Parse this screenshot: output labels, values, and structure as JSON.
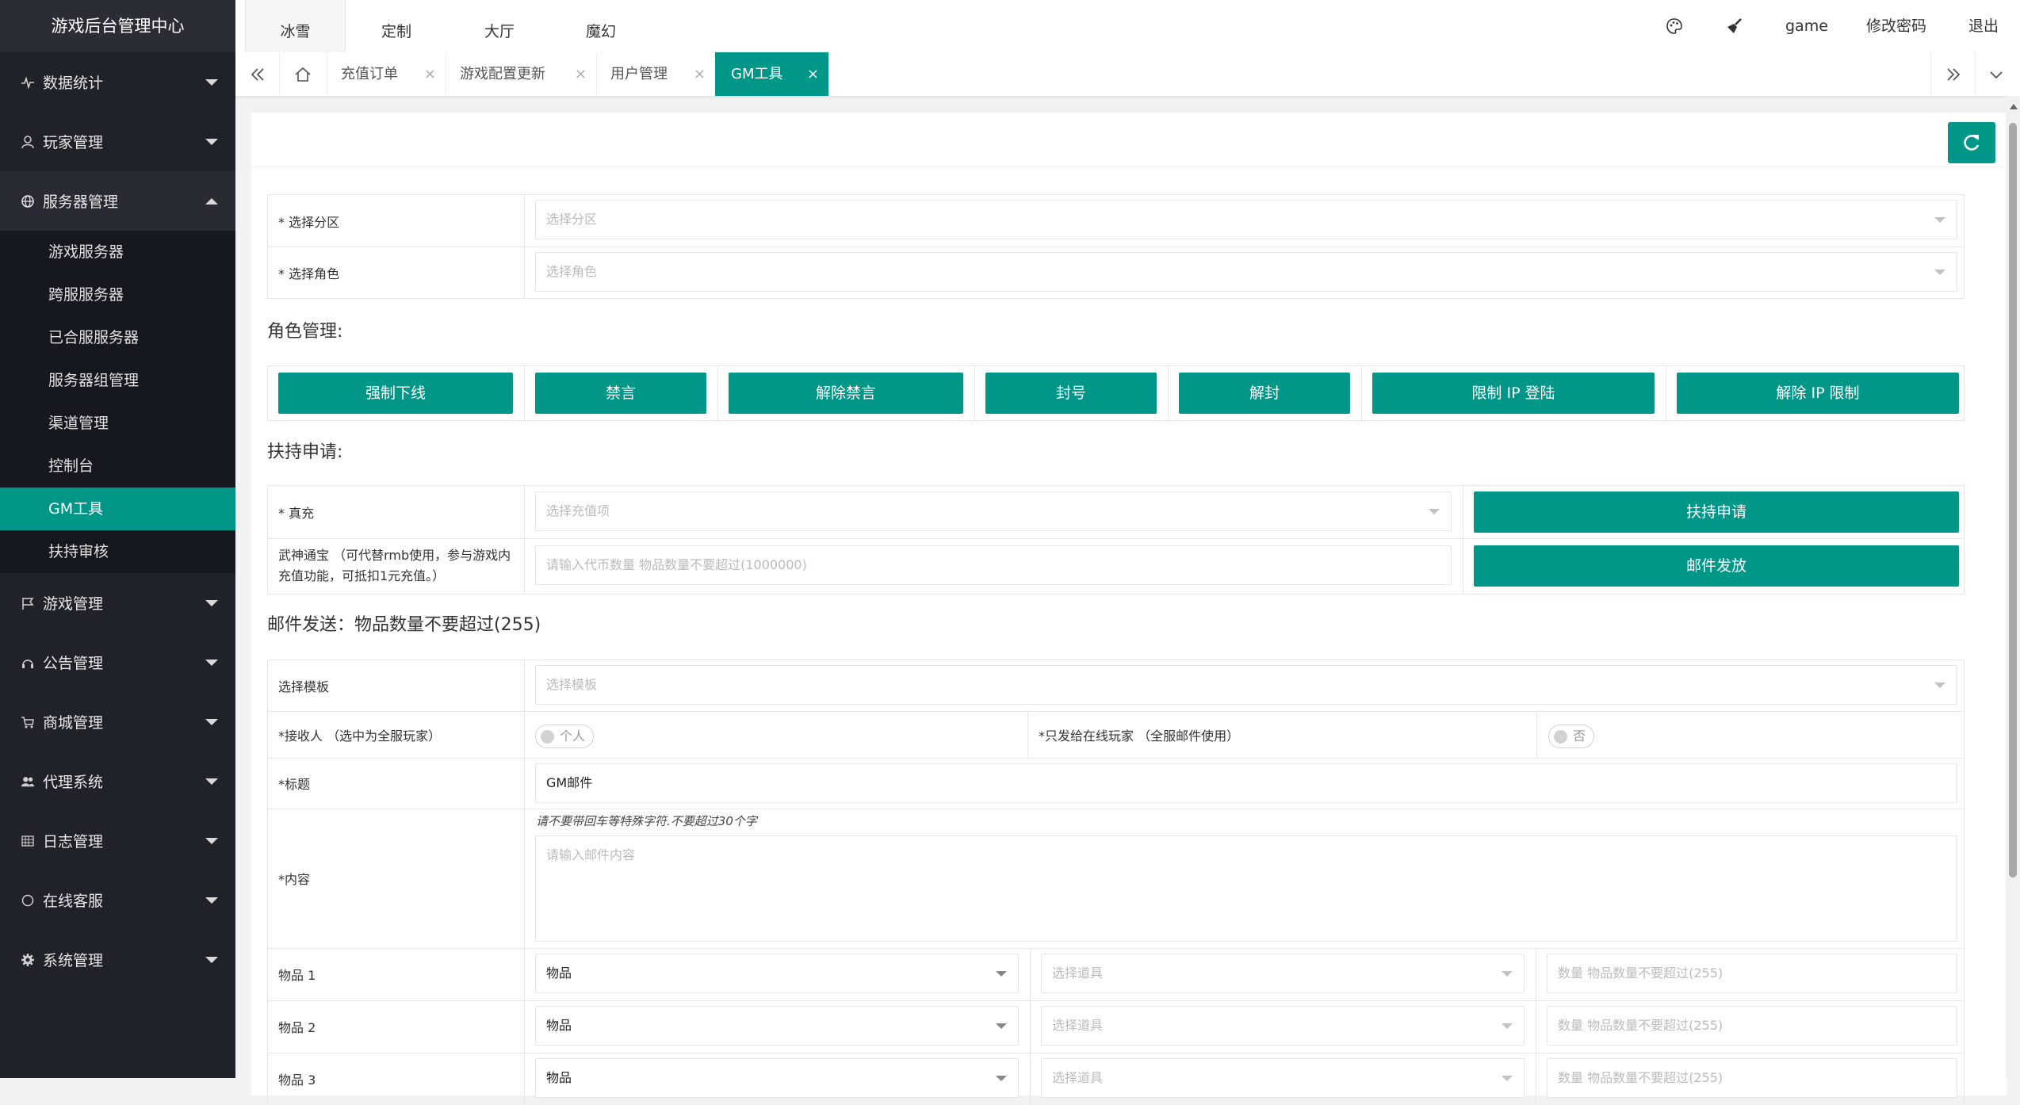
{
  "app_title": "游戏后台管理中心",
  "top_tabs": [
    "冰雪",
    "定制",
    "大厅",
    "魔幻"
  ],
  "header_right": {
    "theme_icon": "palette-icon",
    "clean_icon": "broom-icon",
    "user": "game",
    "change_password": "修改密码",
    "logout": "退出"
  },
  "sidebar": {
    "menus": [
      {
        "label": "数据统计",
        "icon": "pulse-icon"
      },
      {
        "label": "玩家管理",
        "icon": "user-icon"
      },
      {
        "label": "服务器管理",
        "icon": "globe-icon"
      },
      {
        "label": "游戏管理",
        "icon": "flag-icon"
      },
      {
        "label": "公告管理",
        "icon": "headset-icon"
      },
      {
        "label": "商城管理",
        "icon": "cart-icon"
      },
      {
        "label": "代理系统",
        "icon": "users-icon"
      },
      {
        "label": "日志管理",
        "icon": "grid-icon"
      },
      {
        "label": "在线客服",
        "icon": "circle-icon"
      },
      {
        "label": "系统管理",
        "icon": "gear-icon"
      }
    ],
    "submenu": [
      "游戏服务器",
      "跨服服务器",
      "已合服服务器",
      "服务器组管理",
      "渠道管理",
      "控制台",
      "GM工具",
      "扶持审核"
    ],
    "active_submenu": "GM工具"
  },
  "page_tabs": [
    {
      "label": "充值订单",
      "close": "×"
    },
    {
      "label": "游戏配置更新",
      "close": "×"
    },
    {
      "label": "用户管理",
      "close": "×"
    },
    {
      "label": "GM工具",
      "close": "×"
    }
  ],
  "form": {
    "zone_label": "* 选择分区",
    "zone_placeholder": "选择分区",
    "role_label": "* 选择角色",
    "role_placeholder": "选择角色",
    "role_section_title": "角色管理:",
    "role_buttons": [
      "强制下线",
      "禁言",
      "解除禁言",
      "封号",
      "解封",
      "限制 IP 登陆",
      "解除 IP 限制"
    ],
    "support_section_title": "扶持申请:",
    "recharge_label": "* 真充",
    "recharge_placeholder": "选择充值项",
    "support_button": "扶持申请",
    "currency_label": "武神通宝 （可代替rmb使用，参与游戏内充值功能，可抵扣1元充值。）",
    "currency_placeholder": "请输入代币数量  物品数量不要超过(1000000)",
    "mail_send_button": "邮件发放",
    "mail_section_title": "邮件发送：物品数量不要超过(255)",
    "template_label": "选择模板",
    "template_placeholder": "选择模板",
    "receiver_label": "*接收人  （选中为全服玩家）",
    "receiver_switch": "个人",
    "online_label": "*只发给在线玩家  （全服邮件使用）",
    "online_switch": "否",
    "title_label": "*标题",
    "title_value": "GM邮件",
    "content_label": "*内容",
    "content_hint": "请不要带回车等特殊字符.不要超过30个字",
    "content_placeholder": "请输入邮件内容",
    "items": [
      {
        "label": "物品 1",
        "type": "物品",
        "prop_placeholder": "选择道具",
        "qty_placeholder": "数量 物品数量不要超过(255)"
      },
      {
        "label": "物品 2",
        "type": "物品",
        "prop_placeholder": "选择道具",
        "qty_placeholder": "数量 物品数量不要超过(255)"
      },
      {
        "label": "物品 3",
        "type": "物品",
        "prop_placeholder": "选择道具",
        "qty_placeholder": "数量 物品数量不要超过(255)"
      }
    ]
  },
  "colors": {
    "accent": "#009688",
    "sidebar_bg": "#20222a"
  }
}
